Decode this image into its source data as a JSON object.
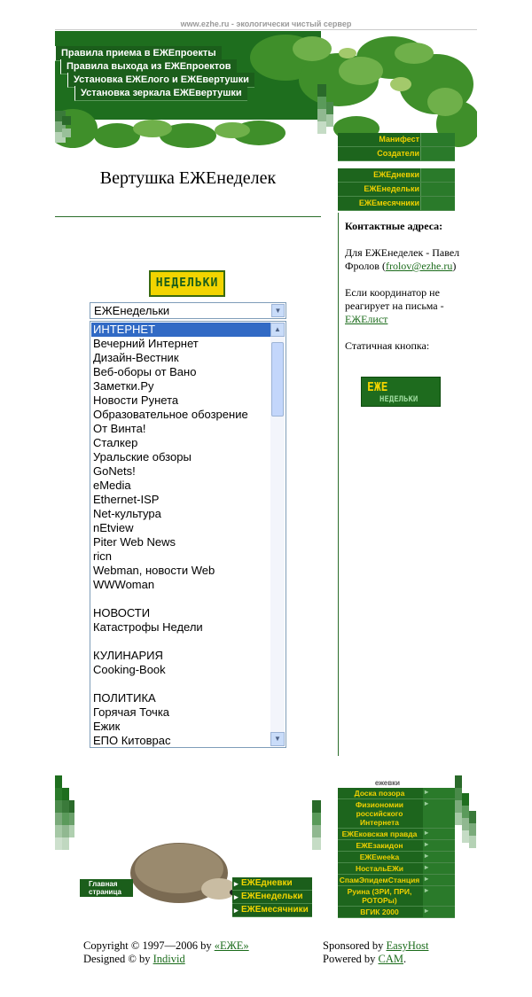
{
  "tagline": "www.ezhe.ru - экологически чистый сервер",
  "header_menu": [
    "Правила приема в ЕЖЕпроекты",
    "Правила выхода из ЕЖЕпроектов",
    "Установка ЕЖЕлого и ЕЖЕвертушки",
    "Установка зеркала ЕЖЕвертушки"
  ],
  "right_menu_top": [
    "Манифест",
    "Создатели"
  ],
  "right_menu_mid": [
    "ЕЖЕдневки",
    "ЕЖЕнедельки",
    "ЕЖЕмесячники"
  ],
  "page_title": "Вертушка ЕЖЕнеделек",
  "nedelki_button": "НЕДЕЛЬКИ",
  "select_value": "ЕЖЕнедельки",
  "list_items": [
    {
      "text": "ИНТЕРНЕТ",
      "selected": true
    },
    {
      "text": "Вечерний Интернет"
    },
    {
      "text": "Дизайн-Вестник"
    },
    {
      "text": "Веб-оборы от Вано"
    },
    {
      "text": "Заметки.Ру"
    },
    {
      "text": "Новости Рунета"
    },
    {
      "text": "Образовательное обозрение"
    },
    {
      "text": "От Винта!"
    },
    {
      "text": "Сталкер"
    },
    {
      "text": "Уральские обзоры"
    },
    {
      "text": "GoNets!"
    },
    {
      "text": "eMedia"
    },
    {
      "text": "Ethernet-ISP"
    },
    {
      "text": "Net-культура"
    },
    {
      "text": "nEtview"
    },
    {
      "text": "Piter Web News"
    },
    {
      "text": "ricn"
    },
    {
      "text": "Webman, новости Web"
    },
    {
      "text": "WWWoman"
    },
    {
      "text": ""
    },
    {
      "text": "НОВОСТИ"
    },
    {
      "text": "Катастрофы Недели"
    },
    {
      "text": ""
    },
    {
      "text": "КУЛИНАРИЯ"
    },
    {
      "text": "Cooking-Book"
    },
    {
      "text": ""
    },
    {
      "text": "ПОЛИТИКА"
    },
    {
      "text": "Горячая Точка"
    },
    {
      "text": "Ежик"
    },
    {
      "text": "ЕПО Китоврас"
    }
  ],
  "contacts": {
    "heading": "Контактные адреса:",
    "p1_prefix": "Для ЕЖЕнеделек - Павел Фролов (",
    "p1_link": "frolov@ezhe.ru",
    "p1_suffix": ")",
    "p2_prefix": "Если координатор не реагирует на письма - ",
    "p2_link": "ЕЖЕлист",
    "p3": "Статичная кнопка:"
  },
  "static_button": {
    "top": "ЕЖЕ",
    "bottom": "НЕДЕЛЬКИ"
  },
  "home_button": "Главная страница",
  "footer_menu_left": [
    "ЕЖЕдневки",
    "ЕЖЕнедельки",
    "ЕЖЕмесячники"
  ],
  "right_footer_head": "ежевки",
  "right_footer_items": [
    "Доска позора",
    "Физиономии российского Интернета",
    "ЕЖЕковская правда",
    "ЕЖЕзакидон",
    "ЕЖЕweeka",
    "НостальЕЖи",
    "СпамЭпидемСтанция",
    "Руина (ЗРИ, ПРИ, РОТОРы)",
    "ВГИК 2000"
  ],
  "footer": {
    "copyright_prefix": "Copyright © 1997—2006 by ",
    "copyright_link": "«ЕЖЕ»",
    "designed_prefix": "Designed © by ",
    "designed_link": "Individ",
    "sponsored_prefix": "Sponsored by ",
    "sponsored_link": "EasyHost",
    "powered_prefix": "Powered by ",
    "powered_link": "CAM",
    "powered_suffix": "."
  },
  "colors": {
    "dark_green": "#1b5e1b",
    "yellow": "#f2d400",
    "select_blue": "#316ac5"
  }
}
